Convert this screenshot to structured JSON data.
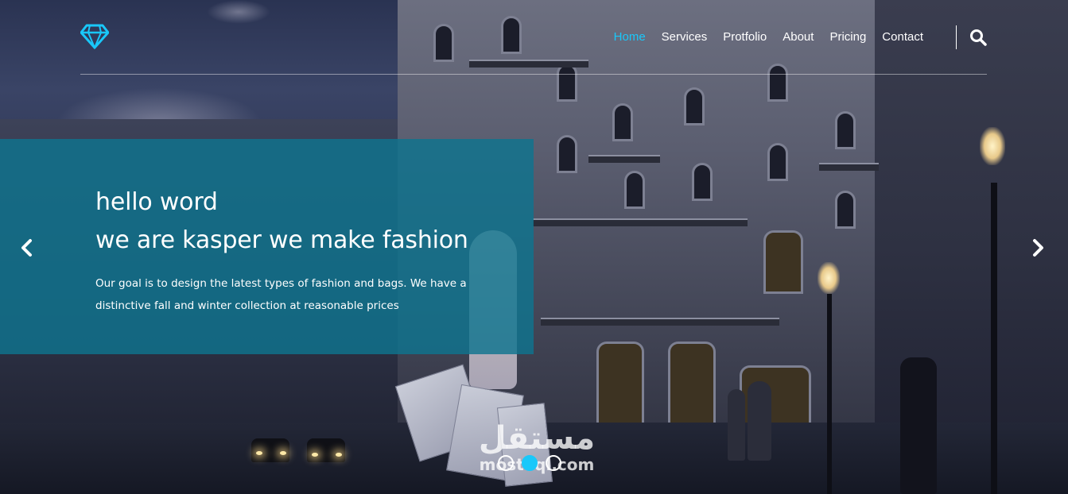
{
  "header": {
    "logo_icon": "diamond-icon",
    "nav": [
      {
        "label": "Home",
        "active": true
      },
      {
        "label": "Services",
        "active": false
      },
      {
        "label": "Protfolio",
        "active": false
      },
      {
        "label": "About",
        "active": false
      },
      {
        "label": "Pricing",
        "active": false
      },
      {
        "label": "Contact",
        "active": false
      }
    ],
    "search_icon": "search-icon"
  },
  "hero": {
    "title_line1": "hello word",
    "title_line2": "we are kasper we make fashion",
    "description": "Our goal is to design the latest types of fashion and bags. We have a distinctive fall and winter collection at reasonable prices"
  },
  "slider": {
    "prev_icon": "chevron-left-icon",
    "next_icon": "chevron-right-icon",
    "bullets": [
      false,
      true,
      false
    ]
  },
  "watermark": {
    "arabic": "مستقل",
    "latin": "mostaql.com"
  },
  "colors": {
    "accent": "#19c8fa",
    "overlay": "#0f748f",
    "text": "#ffffff"
  }
}
